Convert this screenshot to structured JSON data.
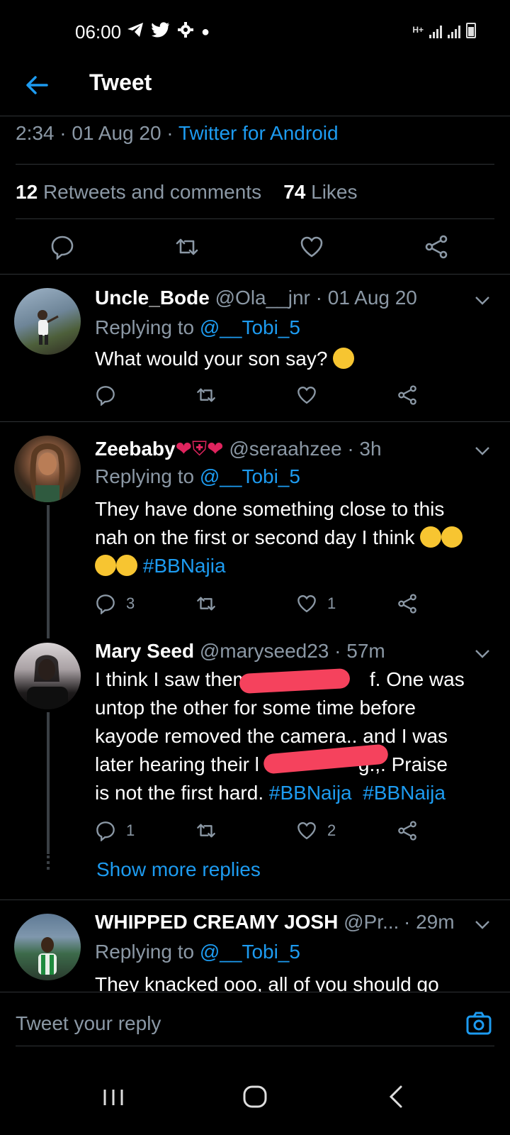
{
  "status_bar": {
    "time": "06:00",
    "network": "H+"
  },
  "appbar": {
    "title": "Tweet"
  },
  "tweet": {
    "time": "2:34",
    "date": "01 Aug 20",
    "dot": "·",
    "source": "Twitter for Android",
    "retweets_count": "12",
    "retweets_label": "Retweets and comments",
    "likes_count": "74",
    "likes_label": "Likes"
  },
  "replies": [
    {
      "name": "Uncle_Bode",
      "handle": "@Ola__jnr",
      "time": "· 01 Aug 20",
      "replying_prefix": "Replying to",
      "replying_handle": "@__Tobi_5",
      "text": "What would your son say?",
      "reply_count": "",
      "like_count": ""
    },
    {
      "name": "Zeebaby",
      "handle": "@seraahzee",
      "time": "· 3h",
      "replying_prefix": "Replying to",
      "replying_handle": "@__Tobi_5",
      "text_line1": "They have done something close to this",
      "text_line2": "nah on the first or second day I think",
      "hashtag": "#BBNajia",
      "reply_count": "3",
      "like_count": "1"
    },
    {
      "name": "Mary Seed",
      "handle": "@maryseed23",
      "time": "· 57m",
      "line1a": "I think I saw them",
      "line1b": "f. One was",
      "line2": "untop the other for some time before",
      "line3": "kayode removed the camera.. and I was",
      "line4a": "later hearing their l",
      "line4b": "g.,.   Praise",
      "line5": "is not the first hard.",
      "hashtag1": "#BBNaija",
      "hashtag2": "#BBNaija",
      "reply_count": "1",
      "like_count": "2"
    },
    {
      "name": "WHIPPED CREAMY JOSH",
      "handle": "@Pr...",
      "time": "· 29m",
      "replying_prefix": "Replying to",
      "replying_handle": "@__Tobi_5",
      "text": "They knacked ooo, all of you should go"
    }
  ],
  "show_more": "Show more replies",
  "reply_bar": {
    "placeholder": "Tweet your reply"
  },
  "colors": {
    "accent": "#1d9bf0",
    "background": "#000000",
    "muted": "#8b98a5",
    "divider": "#2f3336"
  }
}
